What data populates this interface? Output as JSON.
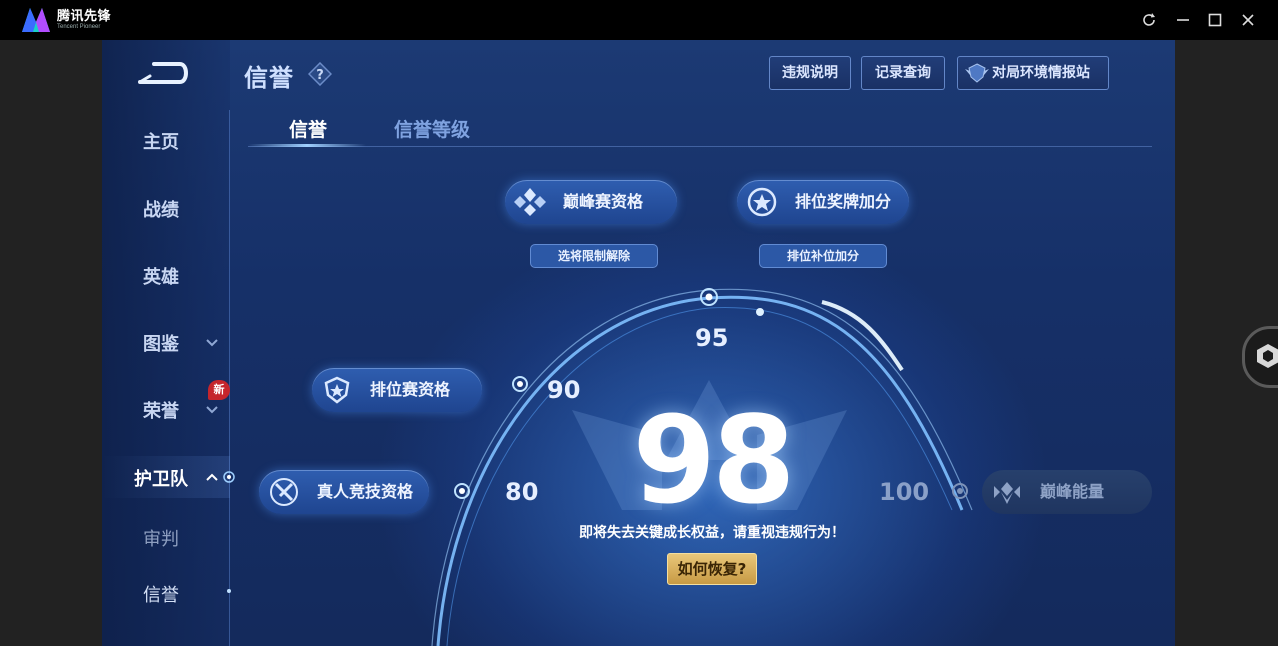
{
  "window": {
    "app_name_cn": "腾讯先锋",
    "app_name_en": "Tencent Pioneer"
  },
  "header": {
    "title": "信誉",
    "buttons": {
      "violation": "违规说明",
      "records": "记录查询",
      "env_station": "对局环境情报站"
    }
  },
  "nav": {
    "items": [
      "主页",
      "战绩",
      "英雄",
      "图鉴",
      "荣誉",
      "护卫队",
      "审判",
      "信誉"
    ],
    "new_badge": "新",
    "active": "护卫队"
  },
  "tabs": [
    "信誉",
    "信誉等级"
  ],
  "tiers": {
    "peak_qualify": "巅峰赛资格",
    "peak_unlock": "选将限制解除",
    "rank_medal": "排位奖牌加分",
    "rank_fill": "排位补位加分",
    "rank_qualify": "排位赛资格",
    "real_player": "真人竞技资格",
    "peak_energy": "巅峰能量"
  },
  "scale": {
    "s80": "80",
    "s90": "90",
    "s95": "95",
    "s100": "100"
  },
  "score": "98",
  "warning": "即将失去关键成长权益，请重视违规行为！",
  "recover_button": "如何恢复?",
  "colors": {
    "bg": "#163068",
    "accent": "#9fd0ff",
    "gold": "#e9c77a",
    "badge_red": "#c5252c"
  }
}
